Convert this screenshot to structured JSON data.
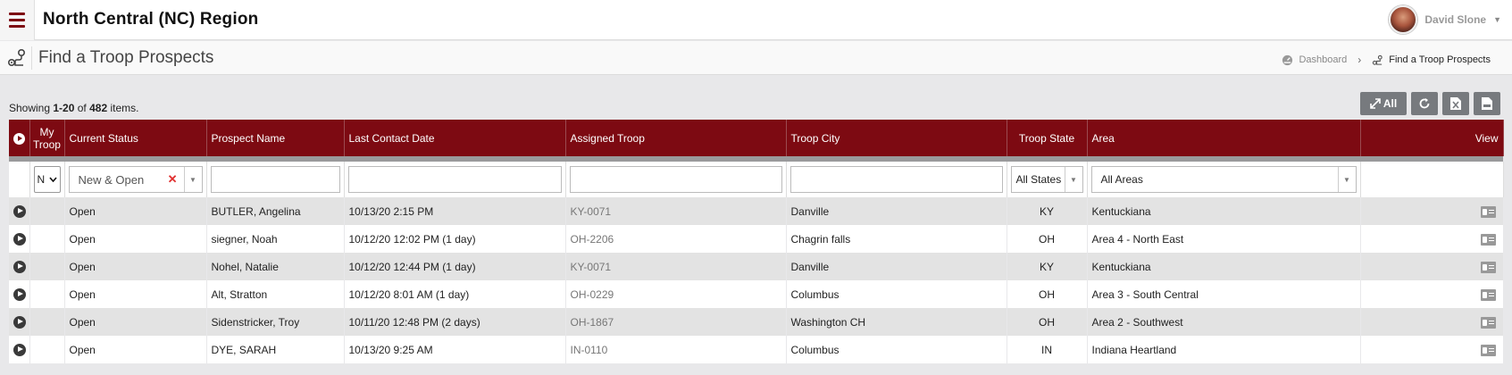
{
  "header": {
    "region_title": "North Central (NC) Region",
    "user_name": "David Slone"
  },
  "page": {
    "title": "Find a Troop Prospects",
    "breadcrumb": {
      "home": "Dashboard",
      "current": "Find a Troop Prospects"
    }
  },
  "summary": {
    "prefix": "Showing ",
    "range": "1-20",
    "middle": " of ",
    "total": "482",
    "suffix": " items."
  },
  "toolbar": {
    "all_label": "All"
  },
  "columns": {
    "my_troop_line1": "My",
    "my_troop_line2": "Troop",
    "current_status": "Current Status",
    "prospect_name": "Prospect Name",
    "last_contact_date": "Last Contact Date",
    "assigned_troop": "Assigned Troop",
    "troop_city": "Troop City",
    "troop_state": "Troop State",
    "area": "Area",
    "view": "View"
  },
  "filters": {
    "my_troop": "N",
    "status": "New & Open",
    "state": "All States",
    "area": "All Areas"
  },
  "rows": [
    {
      "status": "Open",
      "name": "BUTLER, Angelina",
      "date": "10/13/20 2:15 PM",
      "troop": "KY-0071",
      "city": "Danville",
      "state": "KY",
      "area": "Kentuckiana"
    },
    {
      "status": "Open",
      "name": "siegner, Noah",
      "date": "10/12/20 12:02 PM (1 day)",
      "troop": "OH-2206",
      "city": "Chagrin falls",
      "state": "OH",
      "area": "Area 4 - North East"
    },
    {
      "status": "Open",
      "name": "Nohel, Natalie",
      "date": "10/12/20 12:44 PM (1 day)",
      "troop": "KY-0071",
      "city": "Danville",
      "state": "KY",
      "area": "Kentuckiana"
    },
    {
      "status": "Open",
      "name": "Alt, Stratton",
      "date": "10/12/20 8:01 AM (1 day)",
      "troop": "OH-0229",
      "city": "Columbus",
      "state": "OH",
      "area": "Area 3 - South Central"
    },
    {
      "status": "Open",
      "name": "Sidenstricker, Troy",
      "date": "10/11/20 12:48 PM (2 days)",
      "troop": "OH-1867",
      "city": "Washington CH",
      "state": "OH",
      "area": "Area 2 - Southwest"
    },
    {
      "status": "Open",
      "name": "DYE, SARAH",
      "date": "10/13/20 9:25 AM",
      "troop": "IN-0110",
      "city": "Columbus",
      "state": "IN",
      "area": "Indiana Heartland"
    }
  ],
  "colors": {
    "brand": "#7d0a12",
    "row_alt": "#e3e3e3",
    "tool_button": "#777a7e"
  }
}
